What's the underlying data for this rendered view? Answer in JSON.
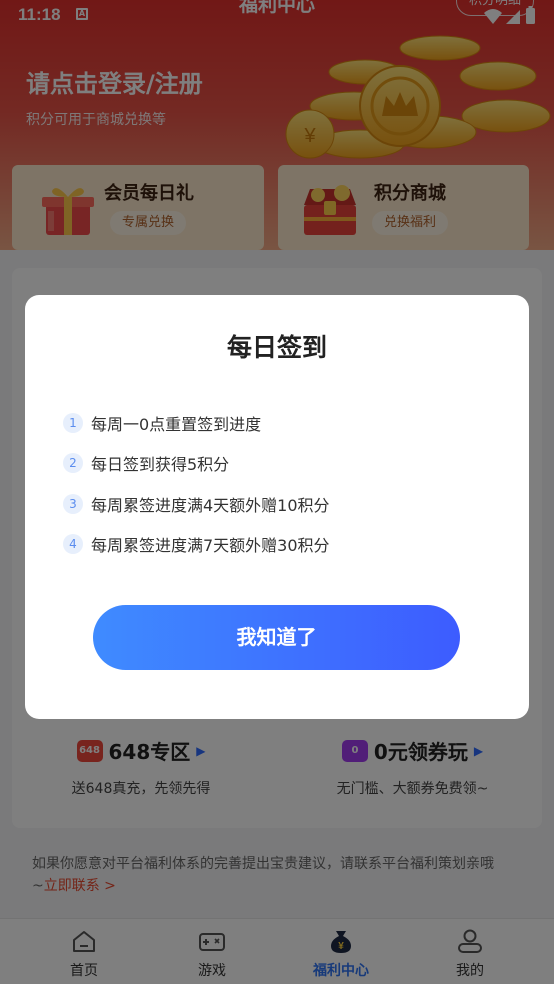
{
  "status_bar": {
    "time": "11:18",
    "notif_icon": "A"
  },
  "header": {
    "title": "福利中心",
    "points_detail": "积分明细"
  },
  "hero": {
    "login_text": "请点击登录/注册",
    "subtitle": "积分可用于商城兑换等"
  },
  "cards": [
    {
      "title": "会员每日礼",
      "tag": "专属兑换",
      "icon": "gift-box-icon"
    },
    {
      "title": "积分商城",
      "tag": "兑换福利",
      "icon": "treasure-chest-icon"
    }
  ],
  "zones": [
    {
      "title": "648专区",
      "badge": "648",
      "subtitle": "送648真充，先领先得",
      "color": "#f0493d"
    },
    {
      "title": "0元领券玩",
      "badge": "0",
      "subtitle": "无门槛、大额券免费领~",
      "color": "#a33cf0"
    }
  ],
  "feedback": {
    "text": "如果你愿意对平台福利体系的完善提出宝贵建议，请联系平台福利策划亲哦",
    "prefix": "~",
    "link": "立即联系 >"
  },
  "tabs": [
    {
      "label": "首页",
      "icon": "home-icon",
      "active": false
    },
    {
      "label": "游戏",
      "icon": "gamepad-icon",
      "active": false
    },
    {
      "label": "福利中心",
      "icon": "money-bag-icon",
      "active": true
    },
    {
      "label": "我的",
      "icon": "user-icon",
      "active": false
    }
  ],
  "dialog": {
    "title": "每日签到",
    "rules": [
      {
        "num": "1",
        "text": "每周一0点重置签到进度"
      },
      {
        "num": "2",
        "text": "每日签到获得5积分"
      },
      {
        "num": "3",
        "text": "每周累签进度满4天额外赠10积分"
      },
      {
        "num": "4",
        "text": "每周累签进度满7天额外赠30积分"
      }
    ],
    "button": "我知道了"
  },
  "colors": {
    "brand_red": "#e2302d",
    "active_blue": "#2f74f5",
    "button_blue": "#3d5cff"
  }
}
